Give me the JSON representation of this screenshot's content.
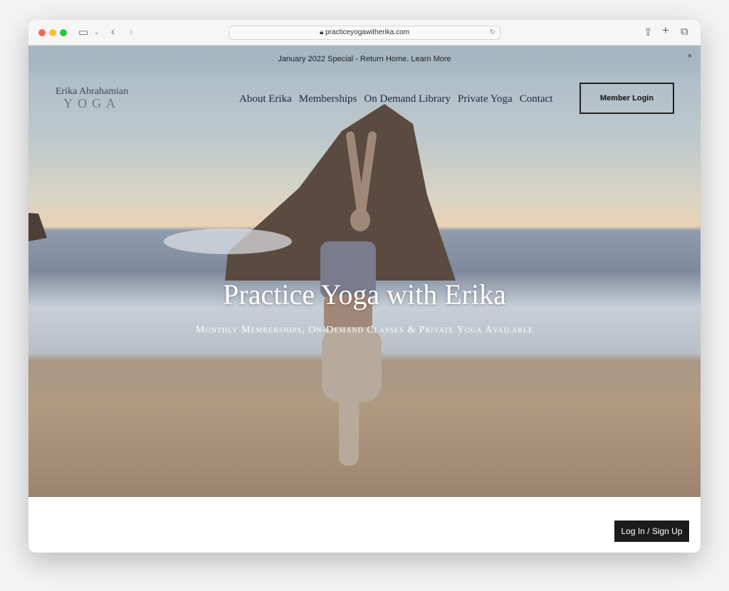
{
  "browser": {
    "url": "practiceyogawitherika.com"
  },
  "banner": {
    "text": "January 2022 Special - Return Home. Learn More",
    "close": "×"
  },
  "logo": {
    "line1": "Erika Abrahamian",
    "line2": "YOGA"
  },
  "nav": {
    "items": [
      "About Erika",
      "Memberships",
      "On Demand Library",
      "Private Yoga",
      "Contact"
    ],
    "login": "Member Login"
  },
  "hero": {
    "title": "Practice Yoga with Erika",
    "subtitle": "Monthly Memberships, On-Demand Classes & Private Yoga Available"
  },
  "footer": {
    "auth_button": "Log In / Sign Up"
  }
}
